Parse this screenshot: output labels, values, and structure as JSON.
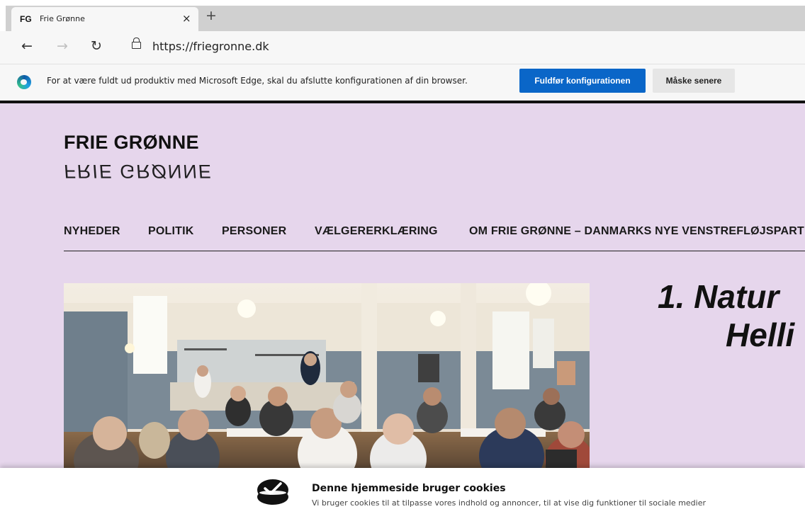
{
  "browser": {
    "tab": {
      "favicon_text": "FG",
      "title": "Frie Grønne",
      "close": "×"
    },
    "new_tab": "+",
    "nav": {
      "back": "←",
      "forward": "→",
      "reload": "↻"
    },
    "url": "https://friegronne.dk"
  },
  "infobar": {
    "message": "For at være fuldt ud produktiv med Microsoft Edge, skal du afslutte konfigurationen af din browser.",
    "primary_button": "Fuldfør konfigurationen",
    "secondary_button": "Måske senere"
  },
  "site": {
    "logo": "FRIE GRØNNE",
    "logo_mirror": "FRIE GRØNNE",
    "nav": [
      {
        "label": "NYHEDER"
      },
      {
        "label": "POLITIK"
      },
      {
        "label": "PERSONER"
      },
      {
        "label": "VÆLGERERKLÆRING"
      },
      {
        "label": "OM FRIE GRØNNE – DANMARKS NYE VENSTREFLØJSPARTI"
      }
    ],
    "hero": {
      "heading_line1": "1.  Natur",
      "heading_line2": "Helli"
    }
  },
  "cookie_banner": {
    "title": "Denne hjemmeside bruger cookies",
    "text": "Vi bruger cookies til at tilpasse vores indhold og annoncer, til at vise dig funktioner til sociale medier"
  },
  "colors": {
    "page_bg": "#e6d6ec",
    "primary_button": "#0a66c8",
    "text_dark": "#111111"
  }
}
